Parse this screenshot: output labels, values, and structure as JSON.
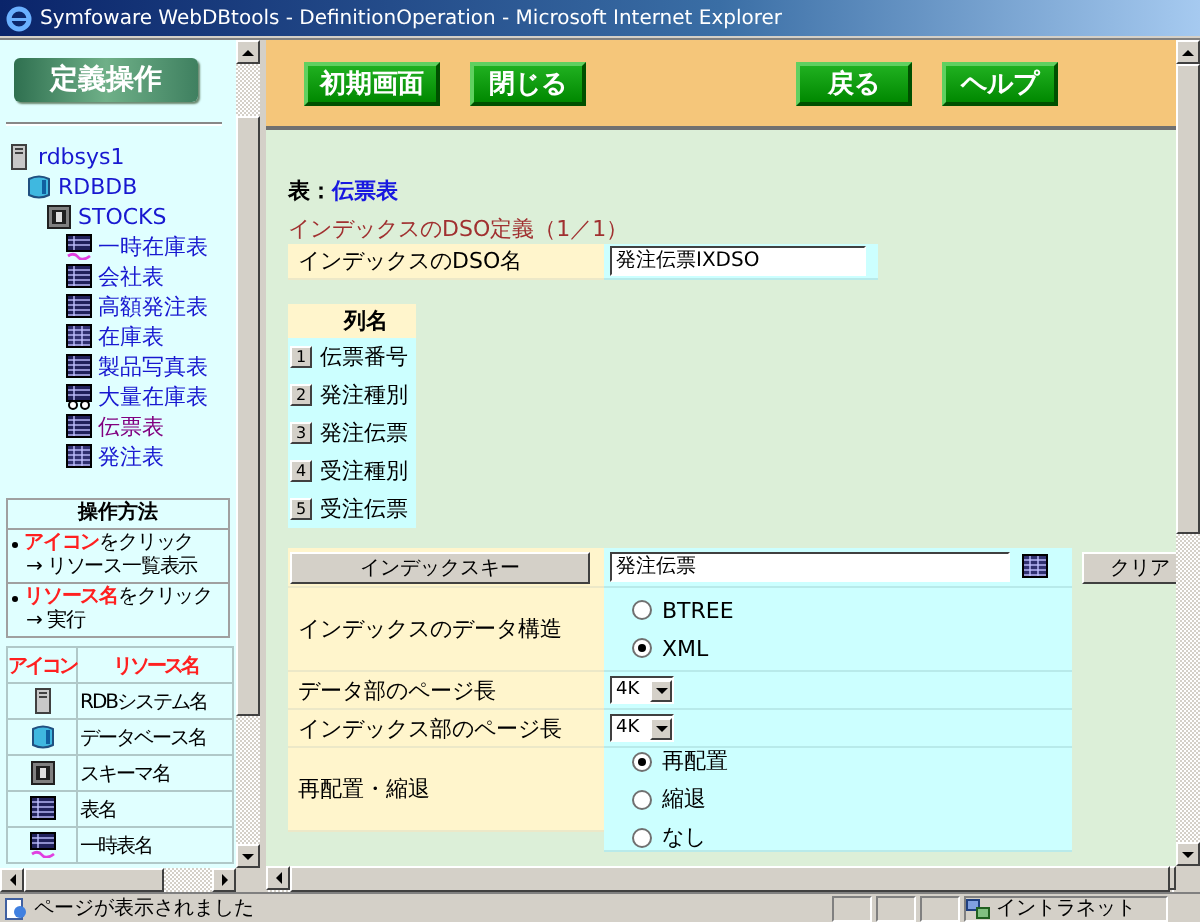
{
  "window": {
    "title": "Symfoware WebDBtools - DefinitionOperation - Microsoft Internet Explorer"
  },
  "sidebar": {
    "header": "定義操作",
    "tree": [
      {
        "label": "rdbsys1",
        "kind": "server",
        "selected": false,
        "children": [
          {
            "label": "RDBDB",
            "kind": "database",
            "selected": false,
            "children": [
              {
                "label": "STOCKS",
                "kind": "schema",
                "selected": false,
                "children": [
                  {
                    "label": "一時在庫表",
                    "kind": "temp-table",
                    "selected": false
                  },
                  {
                    "label": "会社表",
                    "kind": "table",
                    "selected": false
                  },
                  {
                    "label": "高額発注表",
                    "kind": "table",
                    "selected": false
                  },
                  {
                    "label": "在庫表",
                    "kind": "column-table",
                    "selected": false
                  },
                  {
                    "label": "製品写真表",
                    "kind": "table",
                    "selected": false
                  },
                  {
                    "label": "大量在庫表",
                    "kind": "glasses-table",
                    "selected": false
                  },
                  {
                    "label": "伝票表",
                    "kind": "table",
                    "selected": true
                  },
                  {
                    "label": "発注表",
                    "kind": "column-table",
                    "selected": false
                  }
                ]
              }
            ]
          }
        ]
      }
    ],
    "help": {
      "title": "操作方法",
      "items": [
        {
          "action": "**アイコン**をクリック",
          "result": "→ リソース一覧表示"
        },
        {
          "action": "**リソース名**をクリック",
          "result": "→ 実行"
        }
      ]
    },
    "legend": {
      "columns": [
        "アイコン",
        "リソース名"
      ],
      "rows": [
        {
          "kind": "server",
          "name": "RDBシステム名"
        },
        {
          "kind": "database",
          "name": "データベース名"
        },
        {
          "kind": "schema",
          "name": "スキーマ名"
        },
        {
          "kind": "table",
          "name": "表名"
        },
        {
          "kind": "temp-table",
          "name": "一時表名"
        }
      ]
    }
  },
  "toolbar": {
    "left_buttons": [
      "初期画面",
      "閉じる"
    ],
    "right_buttons": [
      "戻る",
      "ヘルプ"
    ]
  },
  "main": {
    "table_label": "表：",
    "table_name": "伝票表",
    "section_title": "インデックスのDSO定義（1／1）",
    "dso_name": {
      "label": "インデックスのDSO名",
      "value": "発注伝票IXDSO"
    },
    "columns": {
      "header": "列名",
      "rows": [
        {
          "number": "1",
          "name": "伝票番号"
        },
        {
          "number": "2",
          "name": "発注種別"
        },
        {
          "number": "3",
          "name": "発注伝票"
        },
        {
          "number": "4",
          "name": "受注種別"
        },
        {
          "number": "5",
          "name": "受注伝票"
        }
      ]
    },
    "index_key": {
      "button": "インデックスキー",
      "value": "発注伝票",
      "clear": "クリア"
    },
    "data_structure": {
      "label": "インデックスのデータ構造",
      "options": [
        {
          "label": "BTREE",
          "selected": false
        },
        {
          "label": "XML",
          "selected": true
        }
      ]
    },
    "data_page": {
      "label": "データ部のページ長",
      "value": "4K"
    },
    "index_page": {
      "label": "インデックス部のページ長",
      "value": "4K"
    },
    "reorganize": {
      "label": "再配置・縮退",
      "options": [
        {
          "label": "再配置",
          "selected": true
        },
        {
          "label": "縮退",
          "selected": false
        },
        {
          "label": "なし",
          "selected": false
        }
      ]
    }
  },
  "status_bar": {
    "message": "ページが表示されました",
    "zone": "イントラネット"
  }
}
